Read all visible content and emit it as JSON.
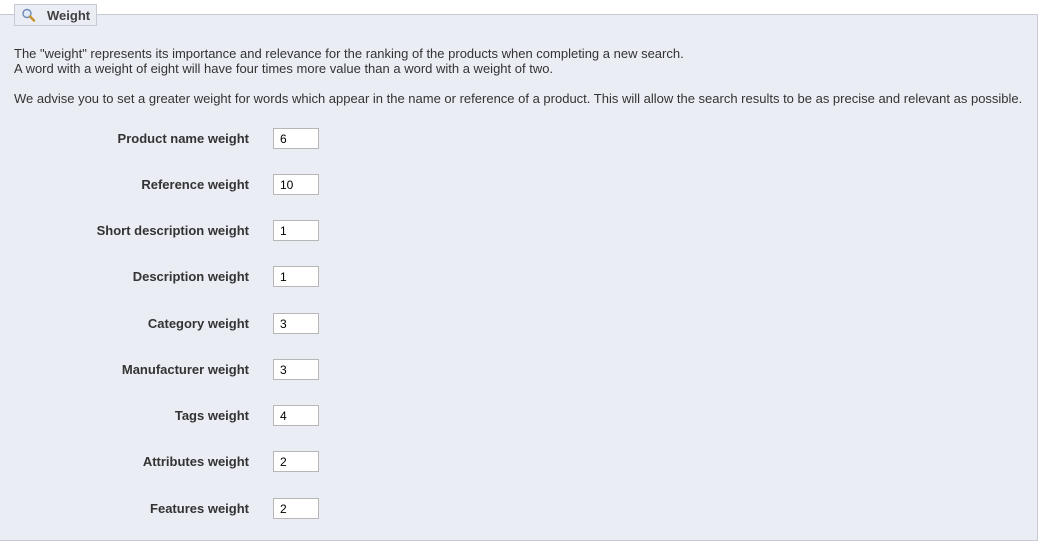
{
  "legend": {
    "title": "Weight",
    "icon": "magnifier-icon"
  },
  "description": {
    "line1": "The \"weight\" represents its importance and relevance for the ranking of the products when completing a new search.",
    "line2": "A word with a weight of eight will have four times more value than a word with a weight of two.",
    "line3": "We advise you to set a greater weight for words which appear in the name or reference of a product. This will allow the search results to be as precise and relevant as possible."
  },
  "fields": [
    {
      "label": "Product name weight",
      "value": "6"
    },
    {
      "label": "Reference weight",
      "value": "10"
    },
    {
      "label": "Short description weight",
      "value": "1"
    },
    {
      "label": "Description weight",
      "value": "1"
    },
    {
      "label": "Category weight",
      "value": "3"
    },
    {
      "label": "Manufacturer weight",
      "value": "3"
    },
    {
      "label": "Tags weight",
      "value": "4"
    },
    {
      "label": "Attributes weight",
      "value": "2"
    },
    {
      "label": "Features weight",
      "value": "2"
    }
  ],
  "colors": {
    "panel_background": "#ebedf4",
    "border": "#c7c9d3",
    "text": "#333333"
  }
}
